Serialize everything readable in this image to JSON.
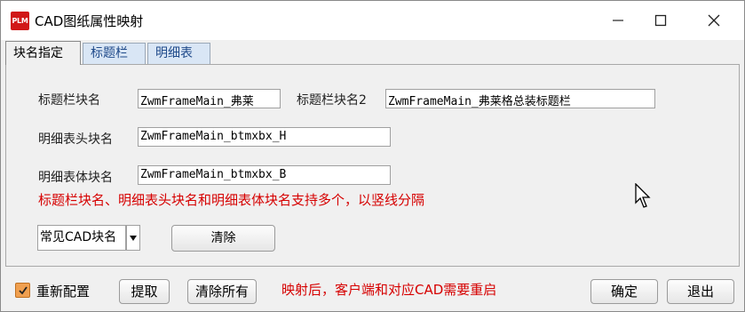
{
  "window": {
    "icon_text": "PLM",
    "title": "CAD图纸属性映射"
  },
  "tabs": [
    {
      "label": "块名指定",
      "active": true
    },
    {
      "label": "标题栏",
      "active": false
    },
    {
      "label": "明细表",
      "active": false
    }
  ],
  "form": {
    "title_block_label": "标题栏块名",
    "title_block_value": "ZwmFrameMain_弗莱",
    "title_block2_label": "标题栏块名2",
    "title_block2_value": "ZwmFrameMain_弗莱格总装标题栏",
    "detail_header_label": "明细表头块名",
    "detail_header_value": "ZwmFrameMain_btmxbx_H",
    "detail_body_label": "明细表体块名",
    "detail_body_value": "ZwmFrameMain_btmxbx_B",
    "hint": "标题栏块名、明细表头块名和明细表体块名支持多个，以竖线分隔",
    "common_block_select": "常见CAD块名",
    "clear_button": "清除"
  },
  "footer": {
    "reset_label": "重新配置",
    "reset_checked": true,
    "extract_button": "提取",
    "clear_all_button": "清除所有",
    "notice": "映射后，客户端和对应CAD需要重启",
    "ok_button": "确定",
    "exit_button": "退出"
  },
  "colors": {
    "hint_red": "#d60000",
    "checkbox_orange": "#f0a050",
    "app_icon_red": "#d11818"
  }
}
